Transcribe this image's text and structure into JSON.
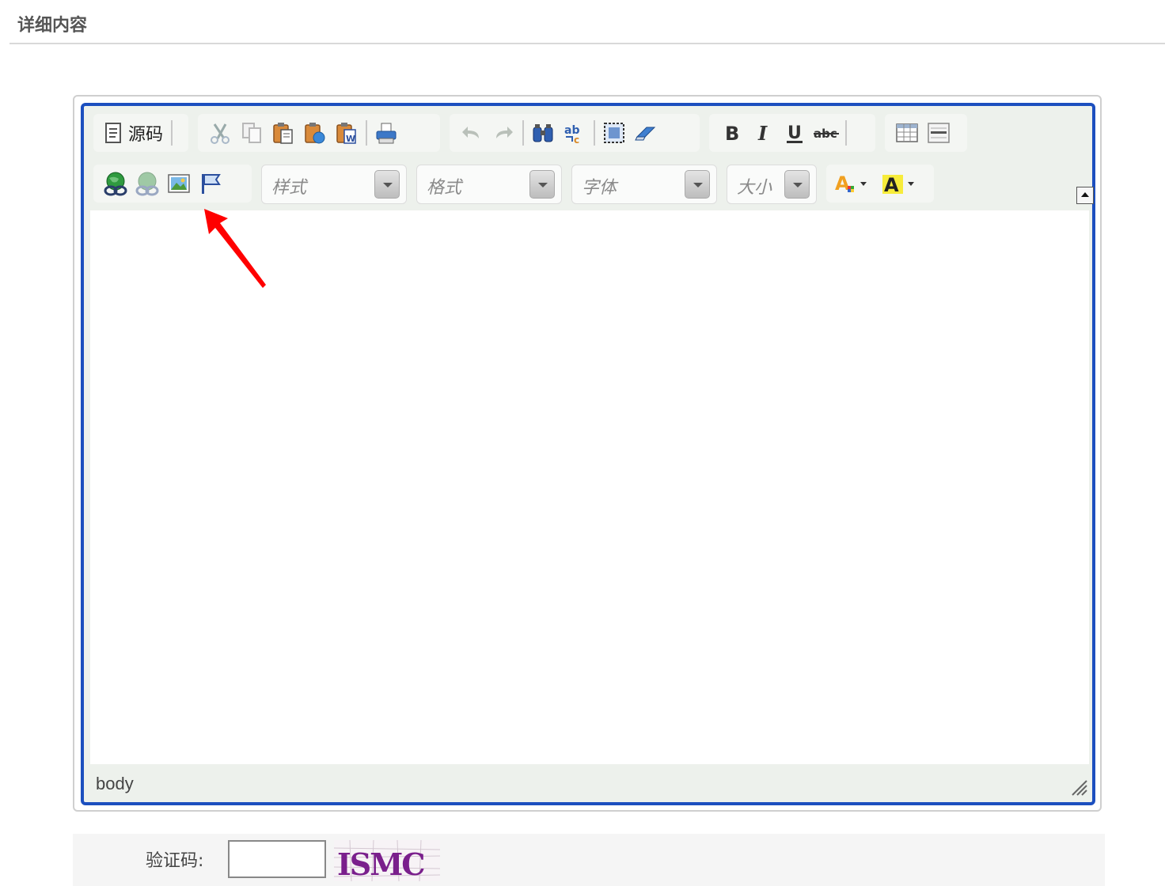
{
  "section": {
    "title": "详细内容"
  },
  "toolbar": {
    "source_label": "源码",
    "combos": {
      "style": "样式",
      "format": "格式",
      "font": "字体",
      "size": "大小"
    }
  },
  "status_bar": {
    "path": "body"
  },
  "captcha": {
    "label": "验证码:",
    "input_value": "",
    "image_text": "ISMC"
  },
  "colors": {
    "editor_border": "#1c4fbf",
    "annotation_arrow": "#ff0000"
  }
}
